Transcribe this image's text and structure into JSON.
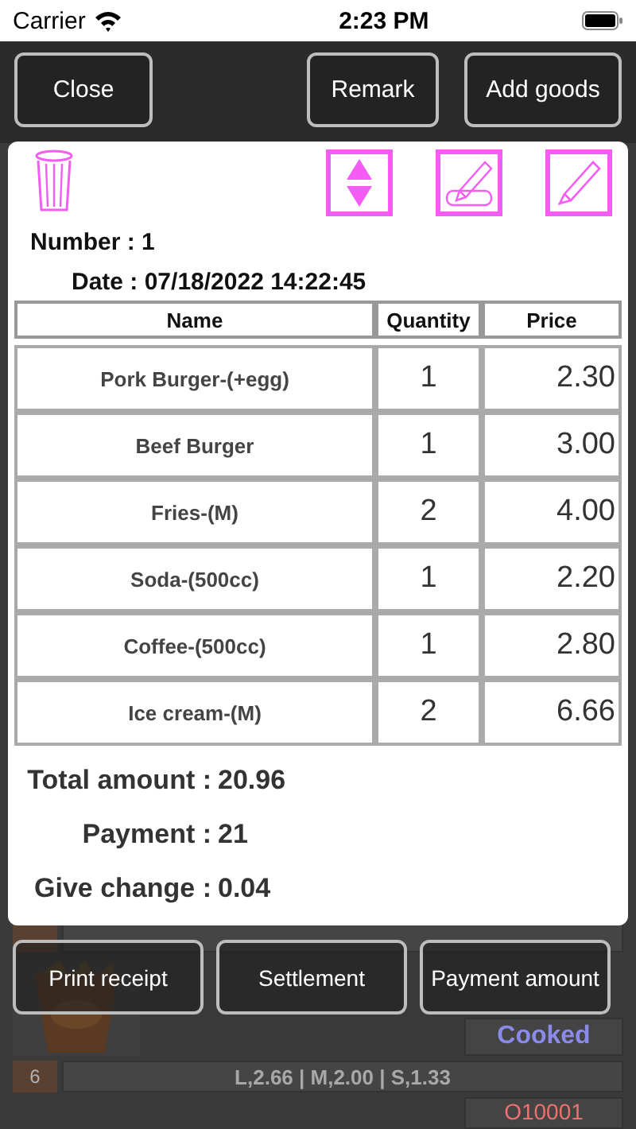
{
  "status_bar": {
    "carrier": "Carrier",
    "time": "2:23 PM"
  },
  "header_buttons": [
    "Close",
    "Remark",
    "Add goods"
  ],
  "background": {
    "status": "Cooked",
    "row_6": {
      "number": "6",
      "options": "L,2.66 | M,2.00 | S,1.33"
    },
    "order_code": "O10001"
  },
  "order": {
    "number": "Number : 1",
    "date": "Date : 07/18/2022 14:22:45",
    "columns": [
      "Name",
      "Quantity",
      "Price"
    ],
    "items": [
      {
        "name": "Pork Burger-(+egg)",
        "quantity": "1",
        "price": "2.30"
      },
      {
        "name": "Beef Burger",
        "quantity": "1",
        "price": "3.00"
      },
      {
        "name": "Fries-(M)",
        "quantity": "2",
        "price": "4.00"
      },
      {
        "name": "Soda-(500cc)",
        "quantity": "1",
        "price": "2.20"
      },
      {
        "name": "Coffee-(500cc)",
        "quantity": "1",
        "price": "2.80"
      },
      {
        "name": "Ice cream-(M)",
        "quantity": "2",
        "price": "6.66"
      }
    ],
    "totals": [
      {
        "label": "Total amount :",
        "value": "20.96"
      },
      {
        "label": "Payment :",
        "value": "21"
      },
      {
        "label": "Give change :",
        "value": "0.04"
      }
    ]
  },
  "footer_buttons": [
    "Print receipt",
    "Settlement",
    "Payment amount"
  ]
}
